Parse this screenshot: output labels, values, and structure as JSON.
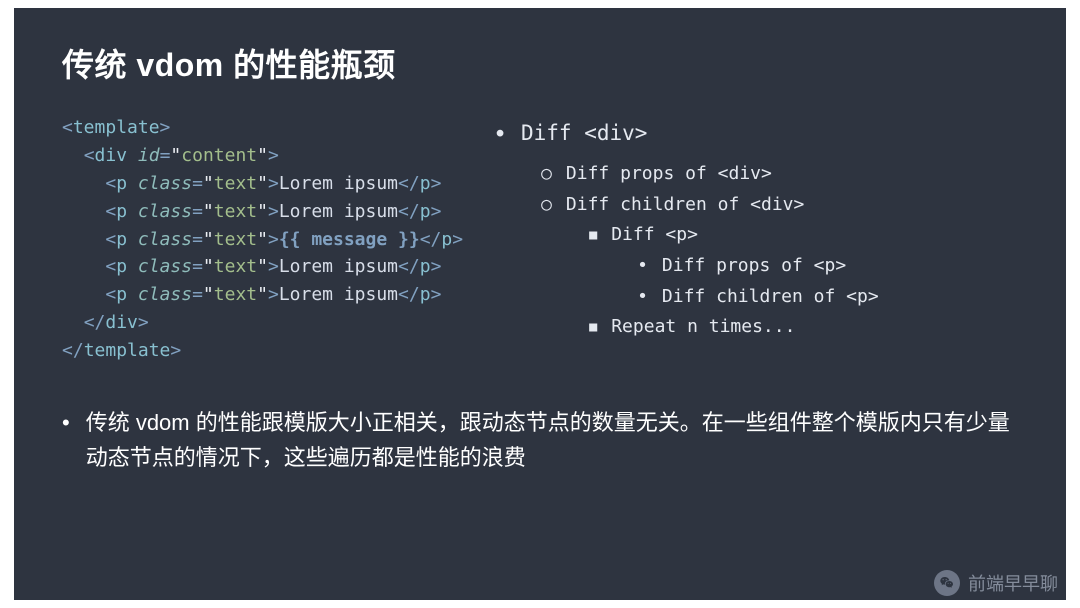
{
  "title": "传统 vdom 的性能瓶颈",
  "code": {
    "l1_open": "template",
    "l2_tag": "div",
    "l2_attr": "id",
    "l2_val": "content",
    "p_tag": "p",
    "p_attr": "class",
    "p_val": "text",
    "p_text": "Lorem ipsum",
    "mustache": "{{ message }}",
    "close_div": "div",
    "close_template": "template"
  },
  "diff": {
    "root": "Diff <div>",
    "l1a": "Diff props of <div>",
    "l1b": "Diff children of <div>",
    "l2a": "Diff <p>",
    "l3a": "Diff props of <p>",
    "l3b": "Diff children of <p>",
    "l2b": "Repeat n times..."
  },
  "summary": "传统 vdom 的性能跟模版大小正相关，跟动态节点的数量无关。在一些组件整个模版内只有少量动态节点的情况下，这些遍历都是性能的浪费",
  "watermark": "前端早早聊"
}
